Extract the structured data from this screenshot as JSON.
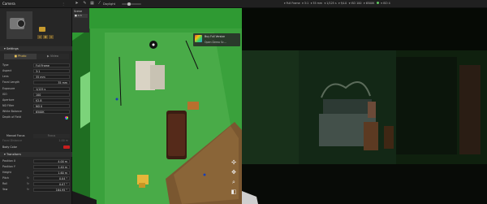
{
  "app": {
    "title": "Camera"
  },
  "topbar": {
    "daylight_label": "Daylight",
    "render_settings": [
      "Full Frame",
      "3:1",
      "35 mm",
      "1/125 s",
      "f/4.0",
      "ISO 100",
      "6500K",
      "ISO 4"
    ]
  },
  "left_panel": {
    "settings_header": "Settings",
    "tabs": {
      "photo": "Photo",
      "video": "Video"
    },
    "properties": [
      {
        "label": "Type",
        "value": "Full Frame"
      },
      {
        "label": "Aspect",
        "value": "3:1"
      },
      {
        "label": "Lens",
        "value": "35 mm"
      },
      {
        "label": "Focal Length",
        "value": "35 mm"
      },
      {
        "label": "Exposure",
        "value": "1/125 s"
      },
      {
        "label": "ISO",
        "value": "100"
      },
      {
        "label": "Aperture",
        "value": "f/2.8"
      },
      {
        "label": "ND Filter",
        "value": "ND 0"
      },
      {
        "label": "White Balance",
        "value": "6500K"
      },
      {
        "label": "Depth of Field",
        "value": ""
      }
    ],
    "manual_focus": {
      "label": "Manual Focus",
      "value": "Focus"
    },
    "focal_distance": {
      "label": "Focal Distance",
      "value": "1.00 m"
    },
    "body_color": {
      "label": "Body Color"
    },
    "transform_header": "Transform",
    "transform": [
      {
        "label": "Position X",
        "value": "4.00 m"
      },
      {
        "label": "Position Y",
        "value": "1.40 m"
      },
      {
        "label": "Height",
        "value": "1.60 m"
      },
      {
        "label": "Pitch",
        "value": "0.04 °"
      },
      {
        "label": "Roll",
        "value": "0.07 °"
      },
      {
        "label": "Yaw",
        "value": "164.95 °"
      }
    ]
  },
  "viewport": {
    "view_label": "Scene",
    "preset": "■ 4:3",
    "buy_hint": {
      "title": "Buy Full Version",
      "subtitle": "Open Demo Sc..."
    }
  },
  "colors": {
    "accent": "#e8c25a",
    "wall_green": "#26892a",
    "floor_wood": "#7a5730",
    "body_color": "#c81e1e"
  }
}
